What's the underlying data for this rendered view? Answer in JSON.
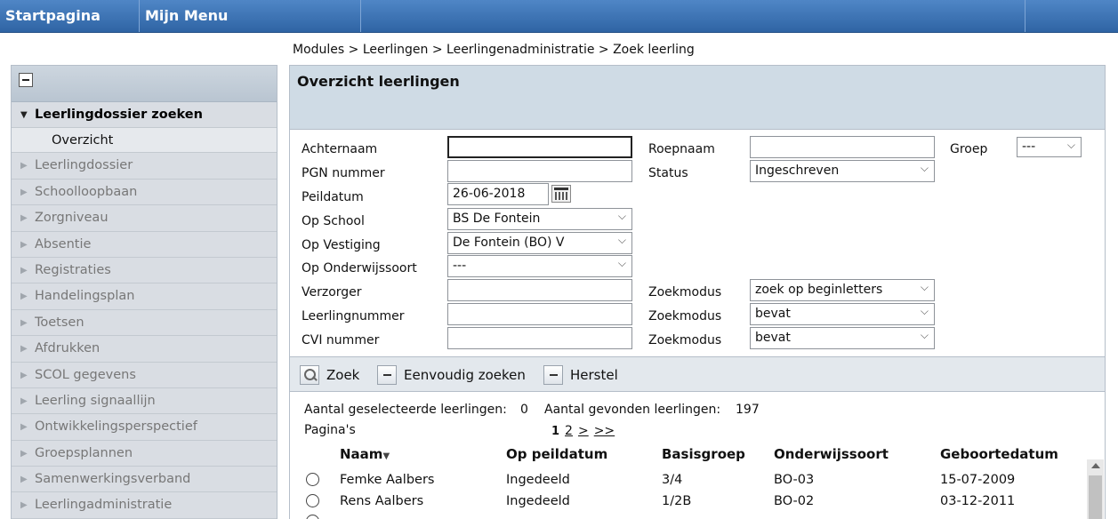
{
  "topnav": {
    "home": "Startpagina",
    "menu": "Mijn Menu"
  },
  "breadcrumb": "Modules > Leerlingen > Leerlingenadministratie > Zoek leerling",
  "sidebar": {
    "active": "Leerlingdossier zoeken",
    "sub": "Overzicht",
    "items": [
      "Leerlingdossier",
      "Schoolloopbaan",
      "Zorgniveau",
      "Absentie",
      "Registraties",
      "Handelingsplan",
      "Toetsen",
      "Afdrukken",
      "SCOL gegevens",
      "Leerling signaallijn",
      "Ontwikkelingsperspectief",
      "Groepsplannen",
      "Samenwerkingsverband",
      "Leerlingadministratie"
    ]
  },
  "panel": {
    "title": "Overzicht leerlingen"
  },
  "form": {
    "achternaam_label": "Achternaam",
    "achternaam_value": "",
    "roepnaam_label": "Roepnaam",
    "roepnaam_value": "",
    "groep_label": "Groep",
    "groep_value": "---",
    "pgn_label": "PGN nummer",
    "pgn_value": "",
    "status_label": "Status",
    "status_value": "Ingeschreven",
    "peildatum_label": "Peildatum",
    "peildatum_value": "26-06-2018",
    "school_label": "Op School",
    "school_value": "BS De Fontein",
    "vestiging_label": "Op Vestiging",
    "vestiging_value": "De Fontein (BO) V",
    "onderwijssoort_label": "Op Onderwijssoort",
    "onderwijssoort_value": "---",
    "verzorger_label": "Verzorger",
    "verzorger_value": "",
    "leerlingnummer_label": "Leerlingnummer",
    "leerlingnummer_value": "",
    "cvi_label": "CVI nummer",
    "cvi_value": "",
    "zoekmodus_label": "Zoekmodus",
    "zoekmodus1": "zoek op beginletters",
    "zoekmodus2": "bevat",
    "zoekmodus3": "bevat"
  },
  "toolbar": {
    "zoek": "Zoek",
    "eenvoudig": "Eenvoudig zoeken",
    "herstel": "Herstel"
  },
  "results": {
    "selected_label": "Aantal geselecteerde leerlingen:",
    "selected_count": "0",
    "found_label": "Aantal gevonden leerlingen:",
    "found_count": "197",
    "pages_label": "Pagina's",
    "pages": [
      "1",
      "2",
      ">",
      ">>"
    ]
  },
  "table": {
    "headers": [
      "Naam",
      "Op peildatum",
      "Basisgroep",
      "Onderwijssoort",
      "Geboortedatum"
    ],
    "rows": [
      [
        "Femke Aalbers",
        "Ingedeeld",
        "3/4",
        "BO-03",
        "15-07-2009"
      ],
      [
        "Rens Aalbers",
        "Ingedeeld",
        "1/2B",
        "BO-02",
        "03-12-2011"
      ]
    ]
  }
}
